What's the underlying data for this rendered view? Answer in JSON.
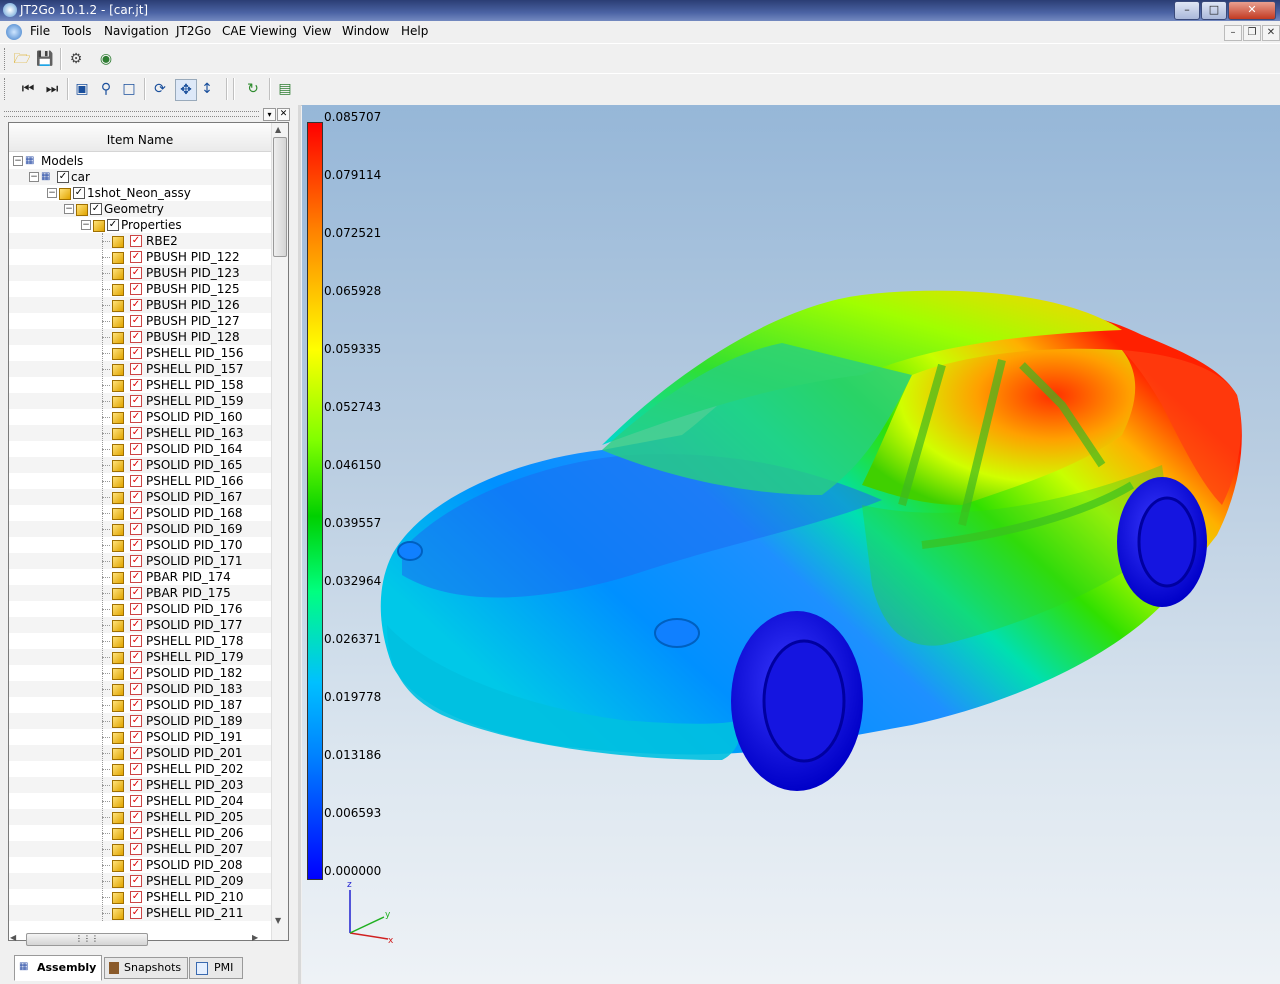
{
  "window": {
    "title": "JT2Go 10.1.2 - [car.jt]",
    "controls": [
      "–",
      "□",
      "✕"
    ]
  },
  "menu": [
    "File",
    "Tools",
    "Navigation",
    "JT2Go",
    "CAE Viewing",
    "View",
    "Window",
    "Help"
  ],
  "mdi_controls": [
    "–",
    "❐",
    "✕"
  ],
  "tree": {
    "column_header": "Item Name",
    "root": "Models",
    "car": "car",
    "assy": "1shot_Neon_assy",
    "geometry": "Geometry",
    "properties": "Properties",
    "items": [
      "RBE2",
      "PBUSH PID_122",
      "PBUSH PID_123",
      "PBUSH PID_125",
      "PBUSH PID_126",
      "PBUSH PID_127",
      "PBUSH PID_128",
      "PSHELL PID_156",
      "PSHELL PID_157",
      "PSHELL PID_158",
      "PSHELL PID_159",
      "PSOLID PID_160",
      "PSHELL PID_163",
      "PSOLID PID_164",
      "PSOLID PID_165",
      "PSHELL PID_166",
      "PSOLID PID_167",
      "PSOLID PID_168",
      "PSOLID PID_169",
      "PSOLID PID_170",
      "PSOLID PID_171",
      "PBAR PID_174",
      "PBAR PID_175",
      "PSOLID PID_176",
      "PSOLID PID_177",
      "PSHELL PID_178",
      "PSHELL PID_179",
      "PSOLID PID_182",
      "PSOLID PID_183",
      "PSOLID PID_187",
      "PSOLID PID_189",
      "PSOLID PID_191",
      "PSOLID PID_201",
      "PSHELL PID_202",
      "PSHELL PID_203",
      "PSHELL PID_204",
      "PSHELL PID_205",
      "PSHELL PID_206",
      "PSHELL PID_207",
      "PSOLID PID_208",
      "PSHELL PID_209",
      "PSHELL PID_210",
      "PSHELL PID_211"
    ]
  },
  "tabs": [
    "Assembly",
    "Snapshots",
    "PMI"
  ],
  "legend": [
    "0.085707",
    "0.079114",
    "0.072521",
    "0.065928",
    "0.059335",
    "0.052743",
    "0.046150",
    "0.039557",
    "0.032964",
    "0.026371",
    "0.019778",
    "0.013186",
    "0.006593",
    "0.000000"
  ],
  "triad": {
    "x": "x",
    "y": "y",
    "z": "z"
  },
  "colors": {
    "title_bar": "#3b5190",
    "legend_max": "#ff0000",
    "legend_min": "#0000ff"
  }
}
